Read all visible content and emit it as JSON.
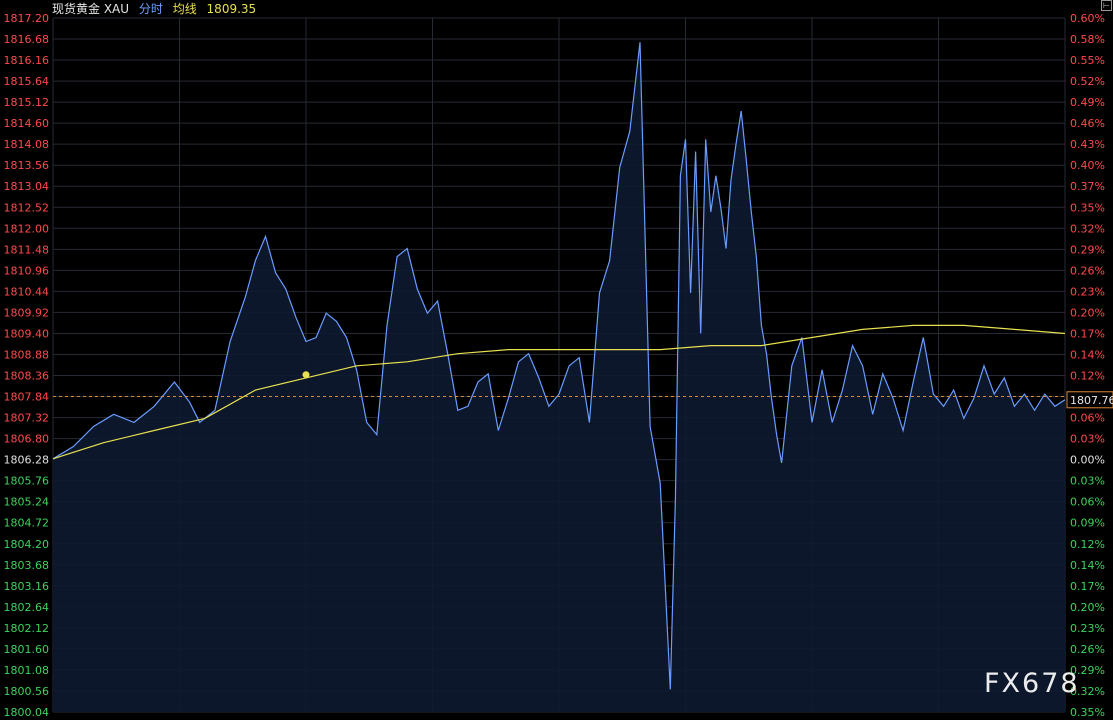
{
  "header": {
    "title": "现货黄金 XAU",
    "series_label": "分时",
    "avg_label": "均线",
    "avg_value": "1809.35"
  },
  "corner_button": "⊢",
  "watermark": "FX678",
  "chart_data": {
    "type": "line",
    "ylim": [
      1800.04,
      1817.2
    ],
    "pct_lim": [
      -0.35,
      0.6
    ],
    "baseline": 1806.28,
    "last_price": 1807.76,
    "last_price_label": "1807.76",
    "reference_line": 1807.84,
    "left_ticks": [
      "1817.20",
      "1816.68",
      "1816.16",
      "1815.64",
      "1815.12",
      "1814.60",
      "1814.08",
      "1813.56",
      "1813.04",
      "1812.52",
      "1812.00",
      "1811.48",
      "1810.96",
      "1810.44",
      "1809.92",
      "1809.40",
      "1808.88",
      "1808.36",
      "1807.84",
      "1807.32",
      "1806.80",
      "1806.28",
      "1805.76",
      "1805.24",
      "1804.72",
      "1804.20",
      "1803.68",
      "1803.16",
      "1802.64",
      "1802.12",
      "1801.60",
      "1801.08",
      "1800.56",
      "1800.04"
    ],
    "right_ticks": [
      "0.60%",
      "0.58%",
      "0.55%",
      "0.52%",
      "0.49%",
      "0.46%",
      "0.43%",
      "0.40%",
      "0.37%",
      "0.35%",
      "0.32%",
      "0.29%",
      "0.26%",
      "0.23%",
      "0.20%",
      "0.17%",
      "0.14%",
      "0.12%",
      "0.09%",
      "0.06%",
      "0.03%",
      "0.00%",
      "0.03%",
      "0.06%",
      "0.09%",
      "0.12%",
      "0.14%",
      "0.17%",
      "0.20%",
      "0.23%",
      "0.26%",
      "0.29%",
      "0.32%",
      "0.35%"
    ],
    "price_x": [
      0,
      0.02,
      0.04,
      0.06,
      0.08,
      0.1,
      0.12,
      0.135,
      0.145,
      0.16,
      0.175,
      0.19,
      0.2,
      0.21,
      0.22,
      0.23,
      0.24,
      0.25,
      0.26,
      0.27,
      0.28,
      0.29,
      0.3,
      0.31,
      0.32,
      0.33,
      0.34,
      0.35,
      0.36,
      0.37,
      0.38,
      0.39,
      0.4,
      0.41,
      0.42,
      0.43,
      0.44,
      0.45,
      0.46,
      0.47,
      0.48,
      0.49,
      0.5,
      0.51,
      0.52,
      0.53,
      0.54,
      0.55,
      0.56,
      0.57,
      0.58,
      0.59,
      0.6,
      0.61,
      0.615,
      0.62,
      0.625,
      0.63,
      0.635,
      0.64,
      0.645,
      0.65,
      0.655,
      0.66,
      0.665,
      0.67,
      0.675,
      0.68,
      0.685,
      0.69,
      0.695,
      0.7,
      0.705,
      0.71,
      0.715,
      0.72,
      0.73,
      0.74,
      0.75,
      0.76,
      0.77,
      0.78,
      0.79,
      0.8,
      0.81,
      0.82,
      0.83,
      0.84,
      0.85,
      0.86,
      0.87,
      0.88,
      0.89,
      0.9,
      0.91,
      0.92,
      0.93,
      0.94,
      0.95,
      0.96,
      0.97,
      0.98,
      0.99,
      1.0
    ],
    "price_y": [
      1806.3,
      1806.6,
      1807.1,
      1807.4,
      1807.2,
      1807.6,
      1808.2,
      1807.7,
      1807.2,
      1807.5,
      1809.2,
      1810.3,
      1811.2,
      1811.8,
      1810.9,
      1810.5,
      1809.8,
      1809.2,
      1809.3,
      1809.9,
      1809.7,
      1809.3,
      1808.5,
      1807.2,
      1806.9,
      1809.6,
      1811.3,
      1811.5,
      1810.5,
      1809.9,
      1810.2,
      1808.9,
      1807.5,
      1807.6,
      1808.2,
      1808.4,
      1807.0,
      1807.8,
      1808.7,
      1808.9,
      1808.3,
      1807.6,
      1807.9,
      1808.6,
      1808.8,
      1807.2,
      1810.4,
      1811.2,
      1813.5,
      1814.4,
      1816.6,
      1807.1,
      1805.7,
      1800.6,
      1805.3,
      1813.3,
      1814.2,
      1810.4,
      1813.9,
      1809.4,
      1814.2,
      1812.4,
      1813.3,
      1812.5,
      1811.5,
      1813.2,
      1814.1,
      1814.9,
      1813.7,
      1812.4,
      1811.3,
      1809.6,
      1808.9,
      1807.8,
      1806.9,
      1806.2,
      1808.6,
      1809.3,
      1807.2,
      1808.5,
      1807.2,
      1808.0,
      1809.1,
      1808.6,
      1807.4,
      1808.4,
      1807.8,
      1807.0,
      1808.2,
      1809.3,
      1807.9,
      1807.6,
      1808.0,
      1807.3,
      1807.8,
      1808.6,
      1807.9,
      1808.3,
      1807.6,
      1807.9,
      1807.5,
      1807.9,
      1807.6,
      1807.76
    ],
    "avg_x": [
      0,
      0.05,
      0.1,
      0.15,
      0.2,
      0.25,
      0.3,
      0.35,
      0.4,
      0.45,
      0.5,
      0.55,
      0.6,
      0.65,
      0.7,
      0.75,
      0.8,
      0.85,
      0.9,
      0.95,
      1.0
    ],
    "avg_y": [
      1806.3,
      1806.7,
      1807.0,
      1807.3,
      1808.0,
      1808.3,
      1808.6,
      1808.7,
      1808.9,
      1809.0,
      1809.0,
      1809.0,
      1809.0,
      1809.1,
      1809.1,
      1809.3,
      1809.5,
      1809.6,
      1809.6,
      1809.5,
      1809.4
    ],
    "avg_marker": [
      0.25,
      1808.38
    ],
    "colors": {
      "price_line": "#6a9cff",
      "price_fill": "#0d1a30",
      "avg_line": "#e8e050",
      "up_tick": "#ff4a4a",
      "down_tick": "#3dd35a",
      "zero_tick": "#e0e0e0",
      "grid": "#262a33",
      "reference": "#d58a3a"
    }
  }
}
